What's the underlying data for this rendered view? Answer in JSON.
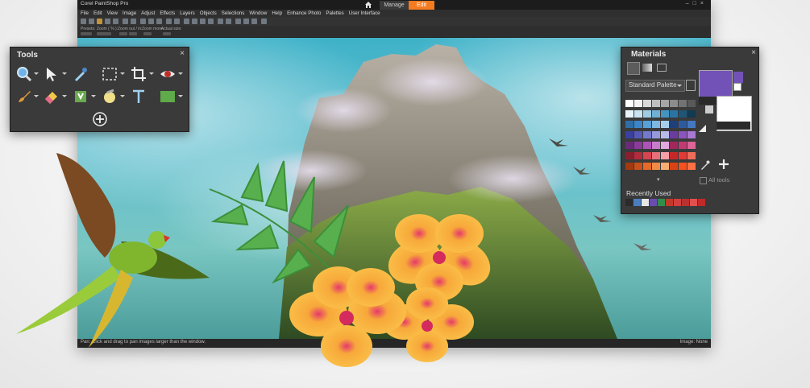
{
  "window": {
    "title": "Corel PaintShop Pro",
    "tabs": {
      "manage": "Manage",
      "edit": "Edit"
    },
    "menus": [
      "File",
      "Edit",
      "View",
      "Image",
      "Adjust",
      "Effects",
      "Layers",
      "Objects",
      "Selections",
      "Window",
      "Help",
      "Enhance Photo",
      "Palettes",
      "User Interface"
    ]
  },
  "options_bar": {
    "presets": "Presets:",
    "zoom": "Zoom ( % ):",
    "zoom_out_in": "Zoom out / in:",
    "zoom_more": "Zoom more:",
    "actual_size": "Actual size:"
  },
  "status": {
    "hint": "Pan: Click and drag to pan images larger than the window.",
    "image": "Image: None"
  },
  "tools_palette": {
    "title": "Tools",
    "close": "×",
    "icons": [
      "zoom-icon",
      "pointer-icon",
      "dropper-icon",
      "selection-icon",
      "crop-icon",
      "red-eye-icon",
      "paint-brush-icon",
      "eraser-icon",
      "fill-icon",
      "smudge-icon",
      "text-icon",
      "rectangle-icon",
      "add-tool-icon"
    ]
  },
  "materials_palette": {
    "title": "Materials",
    "close": "×",
    "palette_select": "Standard Palette",
    "all_tools": "All tools",
    "recently_used": "Recently Used",
    "foreground_color": "#7352b8",
    "background_color": "#ffffff",
    "swatch_rows": [
      [
        "#ffffff",
        "#f2f2f2",
        "#d9d9d9",
        "#bfbfbf",
        "#a6a6a6",
        "#8c8c8c",
        "#737373",
        "#595959"
      ],
      [
        "#e8f4fb",
        "#c9e3f2",
        "#9fcbe4",
        "#6fb0d4",
        "#4594c0",
        "#2a74a3",
        "#1d5678",
        "#123a52"
      ],
      [
        "#2f6ea8",
        "#3b86c8",
        "#5aa0d8",
        "#7db7e2",
        "#a7cfec",
        "#1f3f78",
        "#2d5a9e",
        "#4477c0"
      ],
      [
        "#3b3f9e",
        "#5559b8",
        "#7479cc",
        "#9599dc",
        "#b8bbea",
        "#6a3d9c",
        "#8b55bd",
        "#a878d2"
      ],
      [
        "#6a2a7a",
        "#8c3a9c",
        "#b053b8",
        "#c97bcc",
        "#e0a8e0",
        "#a0285a",
        "#c23a73",
        "#dc6496"
      ],
      [
        "#8a1e2e",
        "#b52a3c",
        "#d64550",
        "#e8707a",
        "#f4a0a6",
        "#c62828",
        "#e53935",
        "#ef6c5a"
      ],
      [
        "#a03a10",
        "#c8501a",
        "#e46a28",
        "#f08a45",
        "#f7ad70",
        "#d84315",
        "#f4511e",
        "#ff7043"
      ]
    ],
    "recent_colors": [
      "#2b2b2b",
      "#4a7ec0",
      "#e6e6e6",
      "#6a4bb0",
      "#2f8f4a",
      "#c0392b",
      "#d04040",
      "#b83232",
      "#e05050",
      "#c02a2a"
    ]
  }
}
